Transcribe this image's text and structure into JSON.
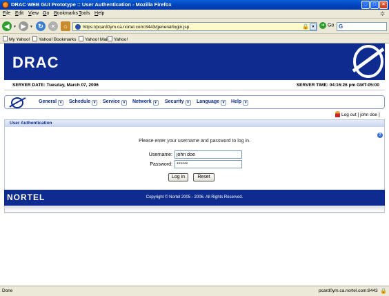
{
  "window": {
    "title": "DRAC WEB GUI Prototype :: User Authentication - Mozilla Firefox",
    "minimize": "_",
    "maximize": "□",
    "close": "×"
  },
  "menubar": {
    "file_hot": "F",
    "file_rest": "ile",
    "edit_hot": "E",
    "edit_rest": "dit",
    "view_hot": "V",
    "view_rest": "iew",
    "go_hot": "G",
    "go_rest": "o",
    "bookmarks_hot": "B",
    "bookmarks_rest": "ookmarks",
    "tools_hot": "T",
    "tools_rest": "ools",
    "help_hot": "H",
    "help_rest": "elp"
  },
  "toolbar": {
    "url": "https://pcard0ym.ca.nortel.com:8443/general/login.jsp",
    "go_label": "Go",
    "search_glyph": "G"
  },
  "bookmarks": [
    "My Yahoo!",
    "Yahoo! Bookmarks",
    "Yahoo! Mail",
    "Yahoo!"
  ],
  "app": {
    "brand": "DRAC",
    "server_date": "SERVER DATE: Tuesday, March 07, 2006",
    "server_time": "SERVER TIME: 04:16:26 pm GMT-05:00",
    "nav": [
      "General",
      "Schedule",
      "Service",
      "Network",
      "Security",
      "Language",
      "Help"
    ],
    "logout": "Log out [ john doe ]"
  },
  "auth": {
    "title": "User Authentication",
    "prompt": "Please enter your username and password to log in.",
    "username_label": "Username:",
    "username_value": "john doe",
    "password_label": "Password:",
    "password_value": "******",
    "login_label": "Log in",
    "reset_label": "Reset",
    "help_glyph": "?"
  },
  "footer": {
    "logo": "NORTEL",
    "copyright": "Copyright © Nortel 2005 - 2006. All Rights Reserved."
  },
  "status": {
    "text": "Done",
    "host": "pcard0ym.ca.nortel.com:8443"
  },
  "colors": {
    "brand_blue": "#0e2b8f",
    "title_bar": "#0a5fd8"
  },
  "icons": [
    "firefox-icon",
    "back-arrow-icon",
    "forward-arrow-icon",
    "reload-icon",
    "stop-icon",
    "home-icon",
    "lock-icon",
    "go-icon",
    "google-icon",
    "bookmark-page-icon",
    "nortel-globe-icon",
    "user-icon",
    "help-icon"
  ]
}
